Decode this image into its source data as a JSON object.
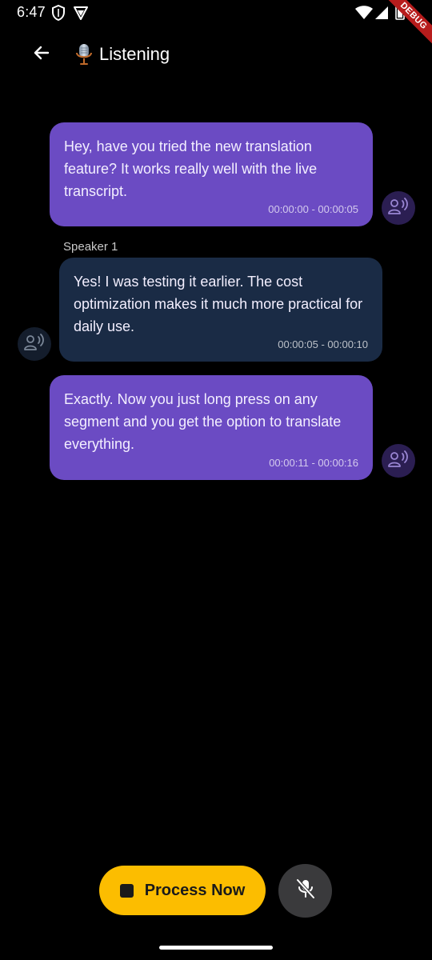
{
  "status_bar": {
    "time": "6:47"
  },
  "debug_banner": {
    "label": "DEBUG"
  },
  "app_bar": {
    "title": "Listening",
    "title_icon": "microphone-icon",
    "back_icon": "arrow-left-icon"
  },
  "messages": [
    {
      "text": "Hey, have you tried the new translation feature? It works really well with the live transcript.",
      "time_range": "00:00:00 - 00:00:05"
    },
    {
      "speaker": "Speaker 1",
      "text": "Yes! I was testing it earlier. The cost optimization makes it much more practical for daily use.",
      "time_range": "00:00:05 - 00:00:10"
    },
    {
      "text": "Exactly. Now you just long press on any segment and you get the option to translate everything.",
      "time_range": "00:00:11 - 00:00:16"
    }
  ],
  "controls": {
    "process_label": "Process Now",
    "mic_icon": "microphone-off-icon"
  },
  "colors": {
    "self_bubble": "#6b4bc3",
    "other_bubble": "#1a2b45",
    "process_button": "#fcbd00",
    "mic_button": "#3a3a3c"
  }
}
